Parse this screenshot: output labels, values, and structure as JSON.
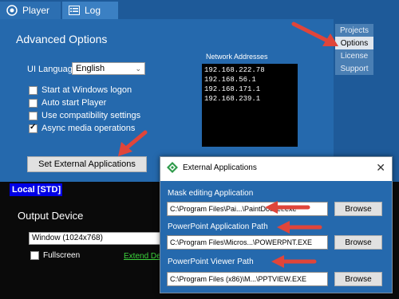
{
  "header": {
    "tabs": [
      {
        "label": "Player",
        "icon": "player-logo-icon"
      },
      {
        "label": "Log",
        "icon": "log-icon"
      }
    ]
  },
  "options": {
    "title": "Advanced Options",
    "ui_language_label": "UI Language",
    "ui_language_value": "English",
    "checkboxes": [
      {
        "label": "Start at Windows logon",
        "checked": false
      },
      {
        "label": "Auto start Player",
        "checked": false
      },
      {
        "label": "Use compatibility settings",
        "checked": false
      },
      {
        "label": "Async media operations",
        "checked": true
      }
    ],
    "network_label": "Network Addresses",
    "network_addresses": [
      "192.168.222.78",
      "192.168.56.1",
      "192.168.171.1",
      "192.168.239.1"
    ],
    "set_external_button": "Set External Applications"
  },
  "side_tabs": [
    {
      "label": "Projects",
      "active": false
    },
    {
      "label": "Options",
      "active": true
    },
    {
      "label": "License",
      "active": false
    },
    {
      "label": "Support",
      "active": false
    }
  ],
  "bottom": {
    "badge": "Local [STD]",
    "output_title": "Output Device",
    "window_select_value": "Window (1024x768)",
    "fullscreen_label": "Fullscreen",
    "extend_link": "Extend Des"
  },
  "dialog": {
    "title": "External Applications",
    "fields": [
      {
        "label": "Mask editing Application",
        "value": "C:\\Program Files\\Pai...\\PaintDotNet.exe",
        "button": "Browse"
      },
      {
        "label": "PowerPoint Application Path",
        "value": "C:\\Program Files\\Micros...\\POWERPNT.EXE",
        "button": "Browse"
      },
      {
        "label": "PowerPoint Viewer Path",
        "value": "C:\\Program Files (x86)\\M...\\PPTVIEW.EXE",
        "button": "Browse"
      }
    ]
  },
  "colors": {
    "panel_blue": "#2569ad",
    "header_blue": "#1e5a99",
    "arrow_red": "#e0453a",
    "badge_blue": "#0000e6",
    "link_green": "#3cd33c"
  }
}
